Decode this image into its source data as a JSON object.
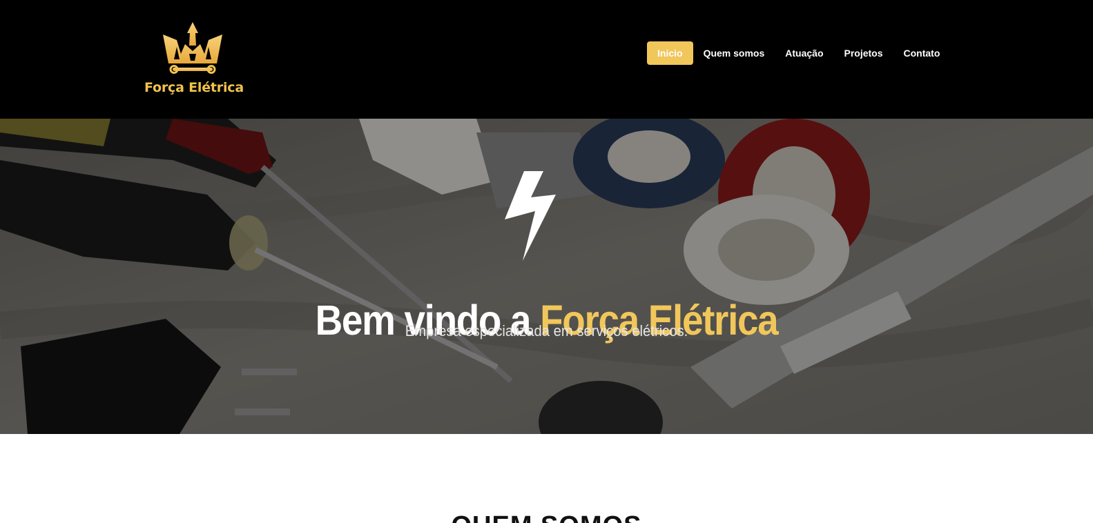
{
  "brand": {
    "name": "Força Elétrica",
    "logo_icon": "crown-icon",
    "accent_color": "#f1c75b"
  },
  "nav": {
    "items": [
      {
        "label": "Inicio",
        "active": true
      },
      {
        "label": "Quem somos",
        "active": false
      },
      {
        "label": "Atuação",
        "active": false
      },
      {
        "label": "Projetos",
        "active": false
      },
      {
        "label": "Contato",
        "active": false
      }
    ]
  },
  "hero": {
    "icon": "lightning-bolt-icon",
    "title_prefix": "Bem vindo a ",
    "title_accent": "Força Elétrica",
    "subtitle": "Empresa especializada em serviços elétricos."
  },
  "next_section": {
    "heading": "QUEM SOMOS"
  }
}
